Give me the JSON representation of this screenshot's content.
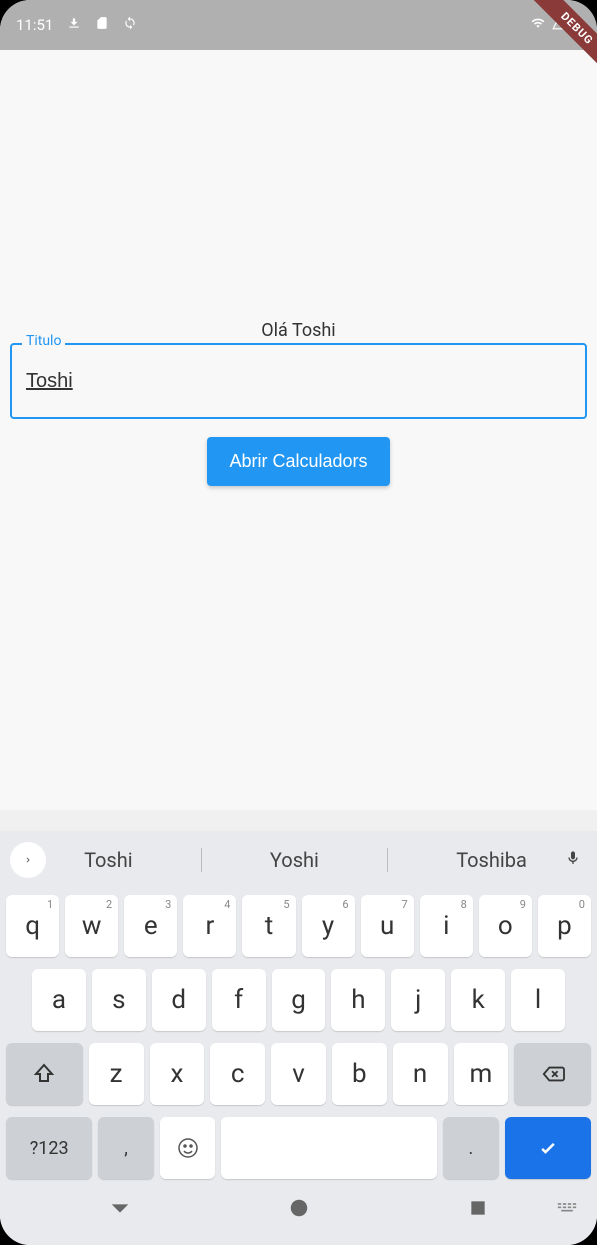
{
  "status": {
    "time": "11:51",
    "debug_label": "DEBUG"
  },
  "app": {
    "greeting": "Olá Toshi",
    "input_label": "Titulo",
    "input_value": "Toshi",
    "button_label": "Abrir Calculadors"
  },
  "keyboard": {
    "suggestions": [
      "Toshi",
      "Yoshi",
      "Toshiba"
    ],
    "row1": [
      {
        "main": "q",
        "sup": "1"
      },
      {
        "main": "w",
        "sup": "2"
      },
      {
        "main": "e",
        "sup": "3"
      },
      {
        "main": "r",
        "sup": "4"
      },
      {
        "main": "t",
        "sup": "5"
      },
      {
        "main": "y",
        "sup": "6"
      },
      {
        "main": "u",
        "sup": "7"
      },
      {
        "main": "i",
        "sup": "8"
      },
      {
        "main": "o",
        "sup": "9"
      },
      {
        "main": "p",
        "sup": "0"
      }
    ],
    "row2": [
      "a",
      "s",
      "d",
      "f",
      "g",
      "h",
      "j",
      "k",
      "l"
    ],
    "row3": [
      "z",
      "x",
      "c",
      "v",
      "b",
      "n",
      "m"
    ],
    "symbols_label": "?123",
    "comma": ",",
    "period": "."
  }
}
